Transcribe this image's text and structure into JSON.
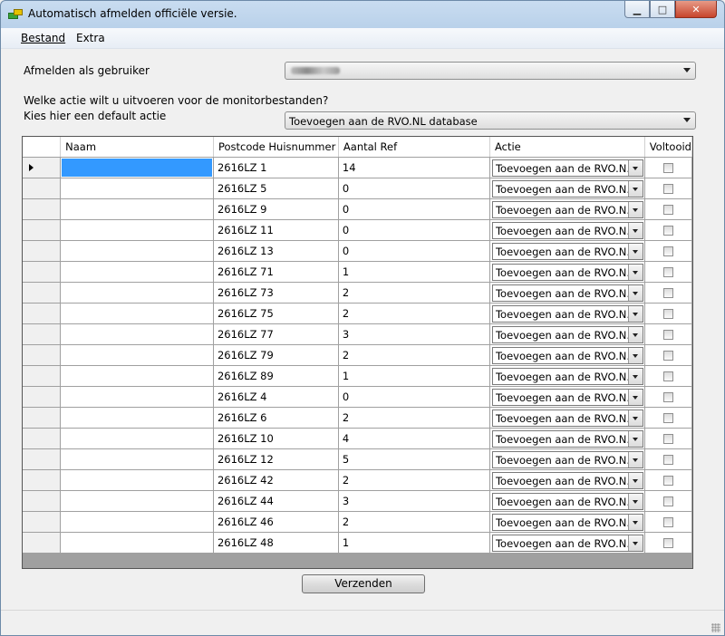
{
  "window": {
    "title": "Automatisch afmelden officiële versie.",
    "caption_min": "▁",
    "caption_max": "□",
    "caption_close": "✕"
  },
  "menu": {
    "items": [
      "Bestand",
      "Extra"
    ]
  },
  "form": {
    "user_label": "Afmelden als gebruiker",
    "user_value": "",
    "question_label": "Welke actie wilt u uitvoeren voor de monitorbestanden?",
    "default_action_label": "Kies hier een default actie",
    "default_action_value": "Toevoegen aan de RVO.NL database"
  },
  "table": {
    "columns": [
      "Naam",
      "Postcode Huisnummer",
      "Aantal Ref",
      "Actie",
      "Voltooid"
    ],
    "rows": [
      {
        "naam": "",
        "postcode": "2616LZ 1",
        "aantal": "14",
        "actie": "Toevoegen aan de RVO.N...",
        "voltooid": false
      },
      {
        "naam": "",
        "postcode": "2616LZ 5",
        "aantal": "0",
        "actie": "Toevoegen aan de RVO.N...",
        "voltooid": false
      },
      {
        "naam": "",
        "postcode": "2616LZ 9",
        "aantal": "0",
        "actie": "Toevoegen aan de RVO.N...",
        "voltooid": false
      },
      {
        "naam": "",
        "postcode": "2616LZ 11",
        "aantal": "0",
        "actie": "Toevoegen aan de RVO.N...",
        "voltooid": false
      },
      {
        "naam": "",
        "postcode": "2616LZ 13",
        "aantal": "0",
        "actie": "Toevoegen aan de RVO.N...",
        "voltooid": false
      },
      {
        "naam": "",
        "postcode": "2616LZ 71",
        "aantal": "1",
        "actie": "Toevoegen aan de RVO.N...",
        "voltooid": false
      },
      {
        "naam": "",
        "postcode": "2616LZ 73",
        "aantal": "2",
        "actie": "Toevoegen aan de RVO.N...",
        "voltooid": false
      },
      {
        "naam": "",
        "postcode": "2616LZ 75",
        "aantal": "2",
        "actie": "Toevoegen aan de RVO.N...",
        "voltooid": false
      },
      {
        "naam": "",
        "postcode": "2616LZ 77",
        "aantal": "3",
        "actie": "Toevoegen aan de RVO.N...",
        "voltooid": false
      },
      {
        "naam": "",
        "postcode": "2616LZ 79",
        "aantal": "2",
        "actie": "Toevoegen aan de RVO.N...",
        "voltooid": false
      },
      {
        "naam": "",
        "postcode": "2616LZ 89",
        "aantal": "1",
        "actie": "Toevoegen aan de RVO.N...",
        "voltooid": false
      },
      {
        "naam": "",
        "postcode": "2616LZ 4",
        "aantal": "0",
        "actie": "Toevoegen aan de RVO.N...",
        "voltooid": false
      },
      {
        "naam": "",
        "postcode": "2616LZ 6",
        "aantal": "2",
        "actie": "Toevoegen aan de RVO.N...",
        "voltooid": false
      },
      {
        "naam": "",
        "postcode": "2616LZ 10",
        "aantal": "4",
        "actie": "Toevoegen aan de RVO.N...",
        "voltooid": false
      },
      {
        "naam": "",
        "postcode": "2616LZ 12",
        "aantal": "5",
        "actie": "Toevoegen aan de RVO.N...",
        "voltooid": false
      },
      {
        "naam": "",
        "postcode": "2616LZ 42",
        "aantal": "2",
        "actie": "Toevoegen aan de RVO.N...",
        "voltooid": false
      },
      {
        "naam": "",
        "postcode": "2616LZ 44",
        "aantal": "3",
        "actie": "Toevoegen aan de RVO.N...",
        "voltooid": false
      },
      {
        "naam": "",
        "postcode": "2616LZ 46",
        "aantal": "2",
        "actie": "Toevoegen aan de RVO.N...",
        "voltooid": false
      },
      {
        "naam": "",
        "postcode": "2616LZ 48",
        "aantal": "1",
        "actie": "Toevoegen aan de RVO.N...",
        "voltooid": false
      }
    ]
  },
  "actions": {
    "submit_label": "Verzenden"
  },
  "colors": {
    "selection": "#3399ff",
    "grid_line": "#a0a0a0",
    "window_frame": "#6d8aa8"
  }
}
